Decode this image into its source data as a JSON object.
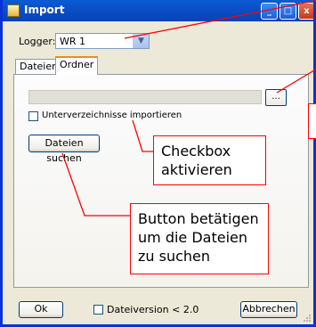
{
  "window": {
    "title": "Import"
  },
  "titlebar_buttons": {
    "minimize": "_",
    "maximize": "□",
    "close": "x"
  },
  "logger": {
    "label": "Logger:",
    "value": "WR 1"
  },
  "tabs": [
    {
      "label": "Dateien"
    },
    {
      "label": "Ordner"
    }
  ],
  "folder": {
    "path": "",
    "browse_label": "..."
  },
  "subdirs_checkbox": {
    "label": "Unterverzeichnisse importieren",
    "checked": false
  },
  "search_button": {
    "label": "Dateien suchen"
  },
  "callouts": {
    "checkbox": "Checkbox aktivieren",
    "button": "Button betätigen um die Dateien zu suchen"
  },
  "footer": {
    "ok_label": "Ok",
    "version_checkbox": {
      "label": "Dateiversion < 2.0",
      "checked": false
    },
    "cancel_label": "Abbrechen"
  },
  "colors": {
    "callout_border": "#ff0000",
    "titlebar": "#0a5cd4",
    "window_bg": "#ece9d8"
  }
}
